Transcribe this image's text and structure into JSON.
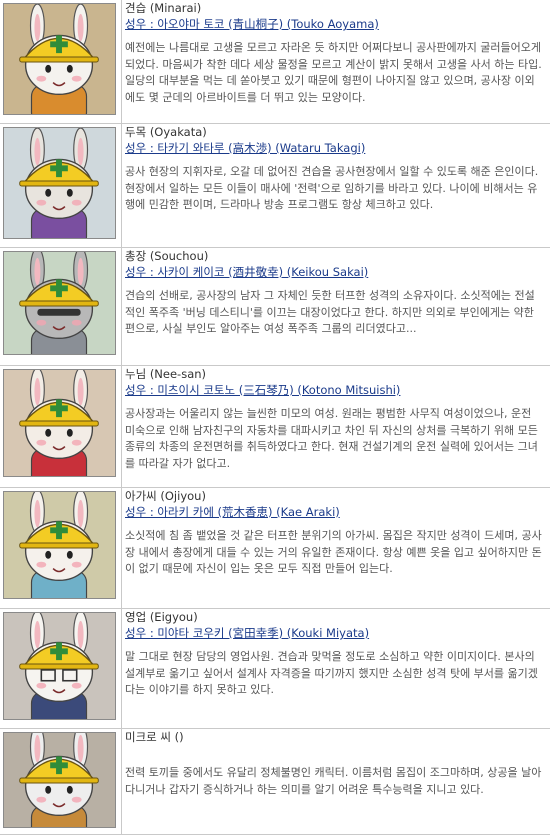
{
  "characters": [
    {
      "name": "견습 (Minarai)",
      "voice": "성우 : 아오야마 토코 (青山桐子) (Touko Aoyama)",
      "desc": "예전에는 나름대로 고생을 모르고 자라온 듯 하지만 어쩌다보니 공사판에까지 굴러들어오게 되었다. 마음씨가 착한 데다 세상 물정을 모르고 계산이 밝지 못해서 고생을 사서 하는 타입. 일당의 대부분을 먹는 데 쏟아붓고 있기 때문에 형편이 나아지질 않고 있으며, 공사장 이외에도 몇 군데의 아르바이트를 더 뛰고 있는 모양이다.",
      "colors": {
        "bg": "#c9b58f",
        "cloth": "#d98c2e",
        "skin": "#f4f2ee"
      }
    },
    {
      "name": "두목 (Oyakata)",
      "voice": "성우 : 타카기 와타루 (高木渉) (Wataru Takagi)",
      "desc": "공사 현장의 지휘자로, 오갈 데 없어진 견습을 공사현장에서 일할 수 있도록 해준 은인이다. 현장에서 일하는 모든 이들이 매사에 '전력'으로 임하기를 바라고 있다. 나이에 비해서는 유행에 민감한 편이며, 드라마나 방송 프로그램도 항상 체크하고 있다.",
      "colors": {
        "bg": "#cfd8dc",
        "cloth": "#7a4fa0",
        "skin": "#e8e4de"
      }
    },
    {
      "name": "총장 (Souchou)",
      "voice": "성우 : 사카이 케이코 (酒井敬幸) (Keikou Sakai)",
      "desc": "견습의 선배로, 공사장의 남자 그 자체인 듯한 터프한 성격의 소유자이다. 소싯적에는 전설적인 폭주족 '버닝 데스티니'를 이끄는 대장이었다고 한다. 하지만 의외로 부인에게는 약한 편으로, 사실 부인도 알아주는 여성 폭주족 그룹의 리더였다고...",
      "colors": {
        "bg": "#c7d6c4",
        "cloth": "#8a8f96",
        "skin": "#b8b8b8"
      }
    },
    {
      "name": "누님 (Nee-san)",
      "voice": "성우 : 미츠이시 코토노 (三石琴乃) (Kotono Mitsuishi)",
      "desc": "공사장과는 어울리지 않는 늘씬한 미모의 여성. 원래는 평범한 사무직 여성이었으나, 운전 미숙으로 인해 남자친구의 자동차를 대파시키고 차인 뒤 자신의 상처를 극복하기 위해 모든 종류의 차종의 운전면허를 취득하였다고 한다. 현재 건설기계의 운전 실력에 있어서는 그녀를 따라갈 자가 없다고.",
      "colors": {
        "bg": "#d7c7b3",
        "cloth": "#c8303a",
        "skin": "#f3ede6"
      }
    },
    {
      "name": "아가씨 (Ojiyou)",
      "voice": "성우 : 아라키 카에 (荒木香恵) (Kae Araki)",
      "desc": "소싯적에 침 좀 뱉었을 것 같은 터프한 분위기의 아가씨. 몸집은 작지만 성격이 드세며, 공사장 내에서 총장에게 대들 수 있는 거의 유일한 존재이다. 항상 예쁜 옷을 입고 싶어하지만 돈이 없기 때문에 자신이 입는 옷은 모두 직접 만들어 입는다.",
      "colors": {
        "bg": "#cfcaa8",
        "cloth": "#6fb0c8",
        "skin": "#f5f1ec"
      }
    },
    {
      "name": "영업 (Eigyou)",
      "voice": "성우 : 미야타 코우키 (宮田幸季) (Kouki Miyata)",
      "desc": "말 그대로 현장 담당의 영업사원. 견습과 맞먹을 정도로 소심하고 약한 이미지이다. 본사의 설계부로 옮기고 싶어서 설계사 자격증을 따기까지 했지만 소심한 성격 탓에 부서를 옮기겠다는 이야기를 하지 못하고 있다.",
      "colors": {
        "bg": "#c9c3bc",
        "cloth": "#3b4a7a",
        "skin": "#f6f4f0"
      }
    },
    {
      "name": "미크로 씨 ()",
      "voice": "",
      "desc": "전력 토끼들 중에서도 유달리 정체불명인 캐릭터. 이름처럼 몸집이 조그마하며, 상공을 날아다니거나 갑자기 증식하거나 하는 의미를 알기 어려운 특수능력을 지니고 있다.",
      "colors": {
        "bg": "#b8b0a4",
        "cloth": "#c68a3a",
        "skin": "#eeeeee"
      }
    }
  ]
}
